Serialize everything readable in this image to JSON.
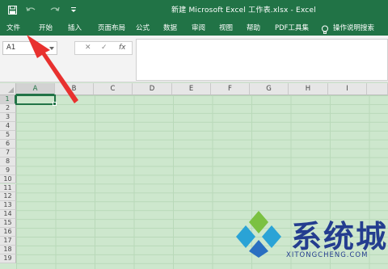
{
  "window": {
    "title": "新建 Microsoft Excel 工作表.xlsx  -  Excel"
  },
  "ribbon": {
    "tabs": [
      "文件",
      "开始",
      "插入",
      "页面布局",
      "公式",
      "数据",
      "审阅",
      "视图",
      "帮助",
      "PDF工具集"
    ],
    "tell_me": "操作说明搜索"
  },
  "formula_bar": {
    "name_box": "A1",
    "cancel_glyph": "✕",
    "enter_glyph": "✓",
    "fx_label": "fx",
    "formula": ""
  },
  "grid": {
    "columns": [
      "A",
      "B",
      "C",
      "D",
      "E",
      "F",
      "G",
      "H",
      "I"
    ],
    "rows": [
      "1",
      "2",
      "3",
      "4",
      "5",
      "6",
      "7",
      "8",
      "9",
      "10",
      "11",
      "12",
      "13",
      "14",
      "15",
      "16",
      "17",
      "18",
      "19"
    ],
    "active_cell": "A1",
    "accent": "#217346",
    "cell_fill": "#cde7cd"
  },
  "watermark": {
    "brand": "系统城",
    "domain": "XITONGCHENG.COM"
  },
  "annotation": {
    "arrow_color": "#e8312f"
  }
}
